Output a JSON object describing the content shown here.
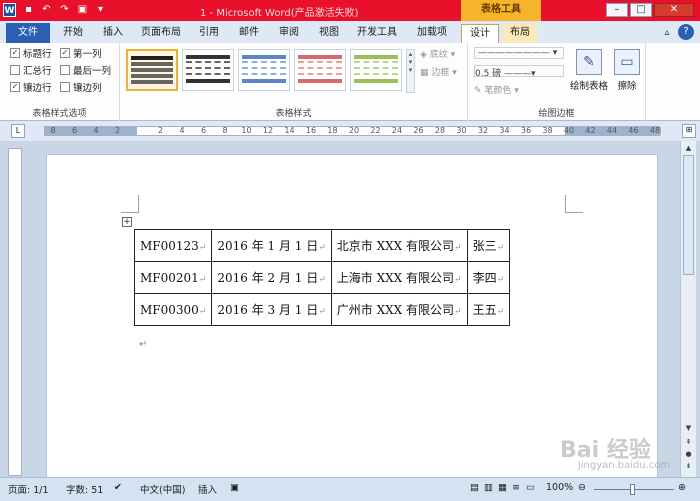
{
  "titlebar": {
    "title": "1 - Microsoft Word(产品激活失败)",
    "context_header": "表格工具",
    "quick_access": [
      "save-icon",
      "undo-icon",
      "redo-icon",
      "print-preview-icon",
      "customize-icon"
    ]
  },
  "tabs": {
    "file": "文件",
    "items": [
      "开始",
      "插入",
      "页面布局",
      "引用",
      "邮件",
      "审阅",
      "视图",
      "开发工具",
      "加载项"
    ],
    "design": "设计",
    "layout": "布局"
  },
  "ribbon": {
    "options": {
      "group_label": "表格样式选项",
      "header_row": "标题行",
      "total_row": "汇总行",
      "banded_rows": "镶边行",
      "first_column": "第一列",
      "last_column": "最后一列",
      "banded_columns": "镶边列"
    },
    "styles": {
      "group_label": "表格样式",
      "shading": "底纹",
      "borders": "边框"
    },
    "borders": {
      "group_label": "绘图边框",
      "pen_weight": "0.5 磅",
      "pen_color": "笔颜色",
      "draw_table": "绘制表格",
      "eraser": "擦除"
    }
  },
  "ruler": {
    "ticks": [
      "8",
      "6",
      "4",
      "2",
      "",
      "2",
      "4",
      "6",
      "8",
      "10",
      "12",
      "14",
      "16",
      "18",
      "20",
      "22",
      "24",
      "26",
      "28",
      "30",
      "32",
      "34",
      "36",
      "38",
      "40",
      "42",
      "44",
      "46",
      "48"
    ]
  },
  "document": {
    "table": [
      [
        "MF00123",
        "2016 年 1 月 1 日",
        "北京市 XXX 有限公司",
        "张三"
      ],
      [
        "MF00201",
        "2016 年 2 月 1 日",
        "上海市 XXX 有限公司",
        "李四"
      ],
      [
        "MF00300",
        "2016 年 3 月 1 日",
        "广州市 XXX 有限公司",
        "王五"
      ]
    ],
    "cell_mark": "↵",
    "paragraph_mark": "↵"
  },
  "statusbar": {
    "page": "页面: 1/1",
    "words": "字数: 51",
    "language": "中文(中国)",
    "mode": "插入",
    "zoom": "100%"
  },
  "watermark": {
    "brand": "Bai 经验",
    "sub": "jingyan.baidu.com"
  },
  "colors": {
    "titlebar": "#e8102a",
    "context_tab": "#f6b42a",
    "file_tab": "#2b5fb4"
  }
}
